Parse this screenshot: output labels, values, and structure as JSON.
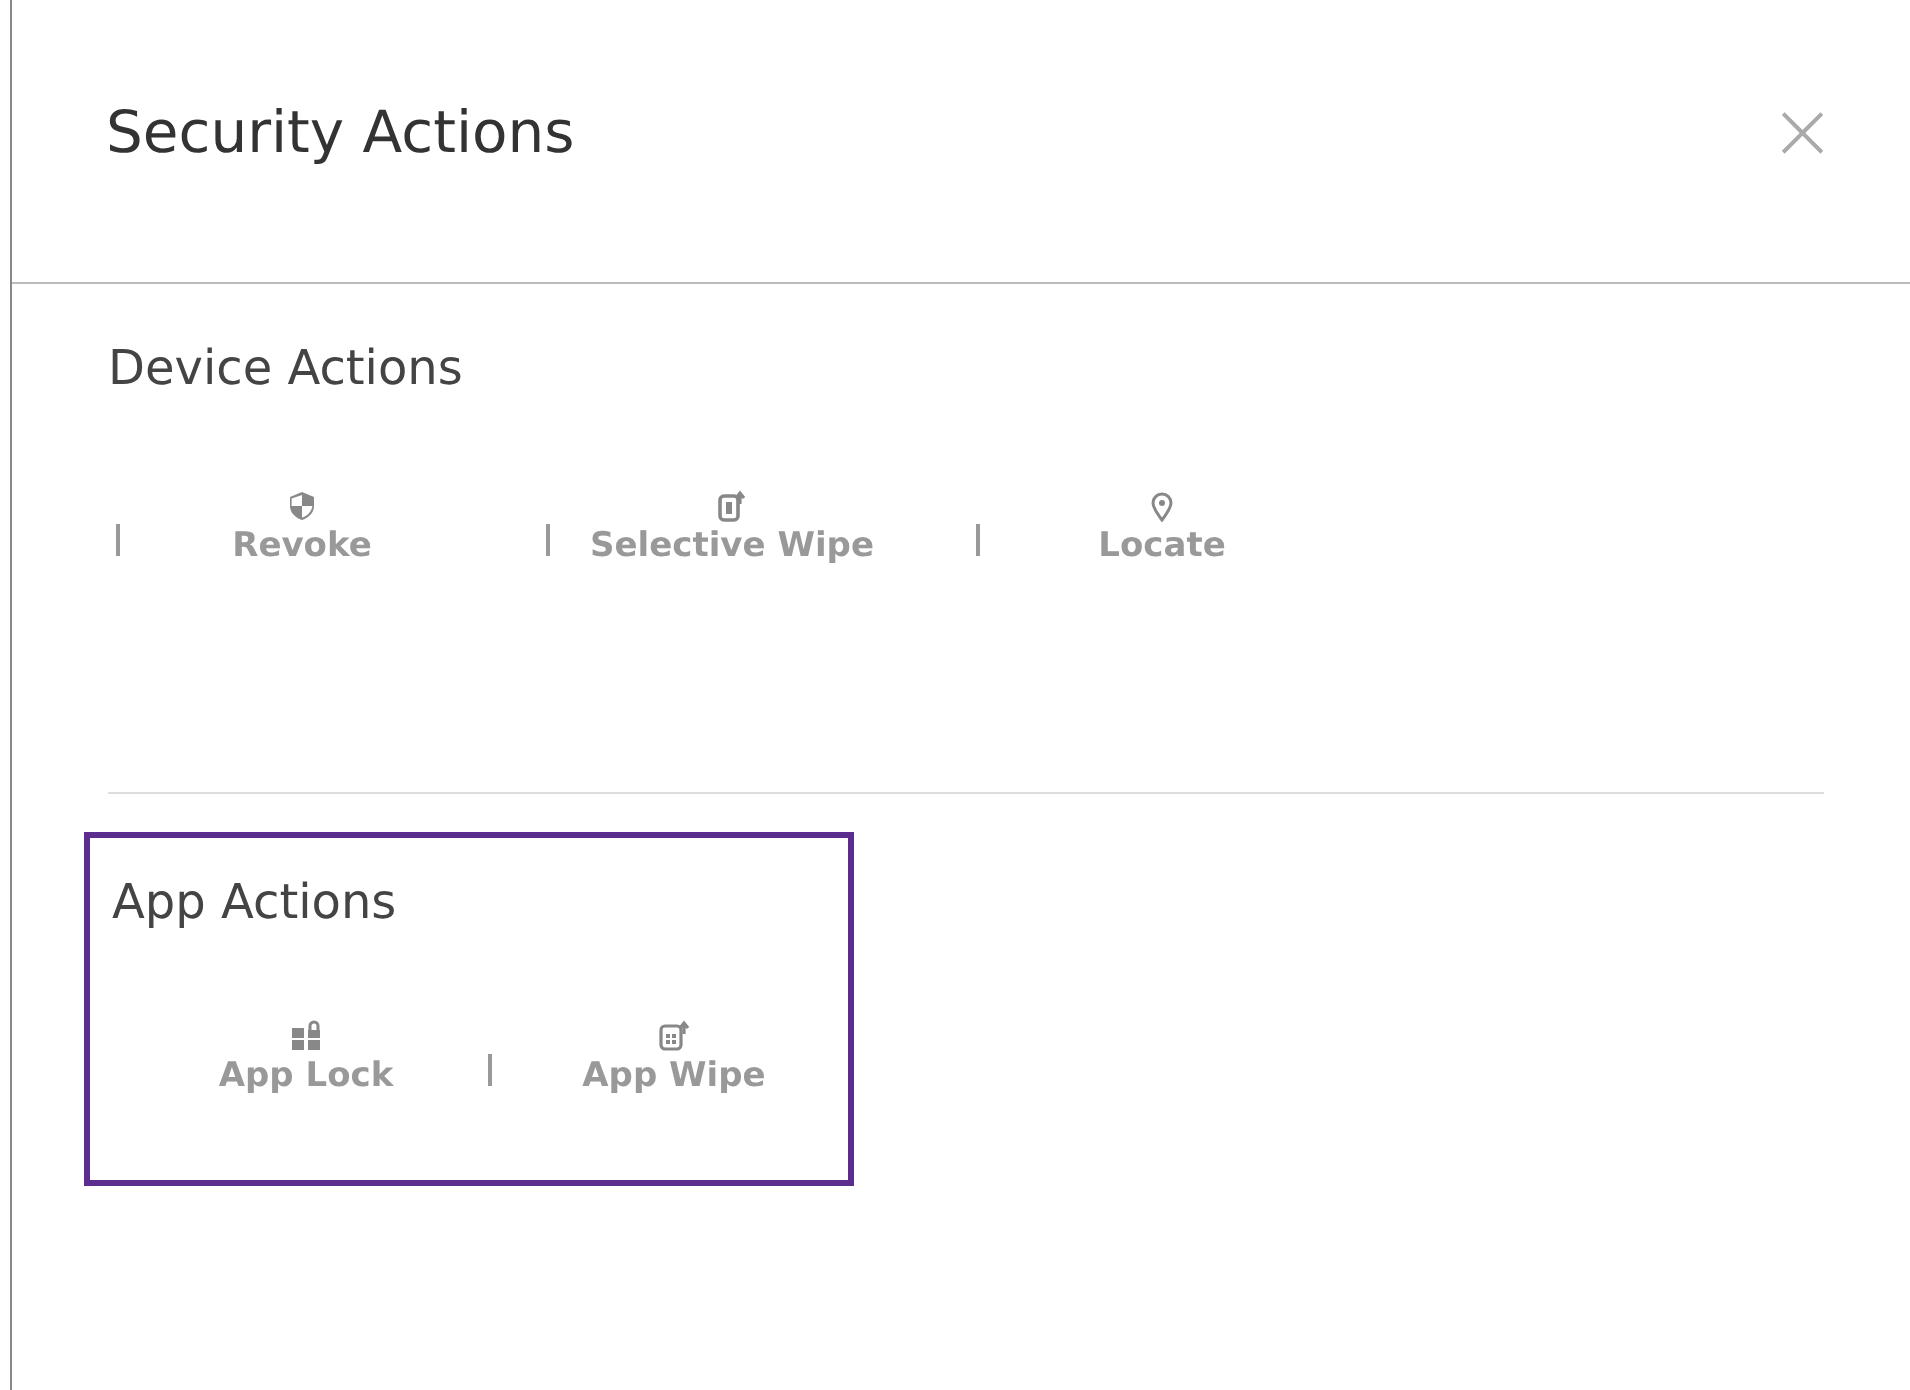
{
  "dialog": {
    "title": "Security Actions",
    "close": "×"
  },
  "sections": [
    {
      "title": "Device Actions",
      "highlighted": false,
      "items": [
        {
          "label": "Revoke",
          "kind": "shield",
          "divider": true
        },
        {
          "label": "Selective Wipe",
          "kind": "wipe",
          "divider": true
        },
        {
          "label": "Locate",
          "kind": "pin",
          "divider": true
        }
      ]
    },
    {
      "title": "App Actions",
      "highlighted": true,
      "items": [
        {
          "label": "App Lock",
          "kind": "lock",
          "divider": false
        },
        {
          "label": "App Wipe",
          "kind": "appwipe",
          "divider": true
        }
      ]
    }
  ]
}
